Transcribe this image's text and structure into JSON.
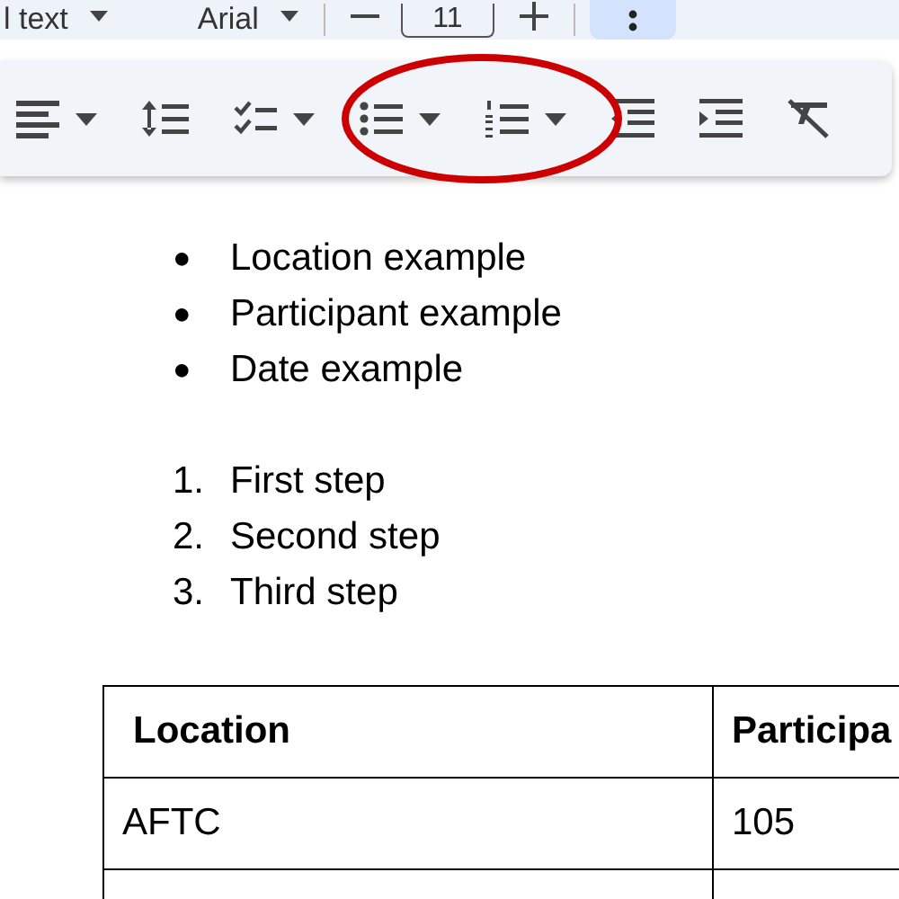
{
  "top_bar": {
    "style": "l text",
    "font": "Arial",
    "size": "11"
  },
  "toolbar": {
    "highlighted_group": true
  },
  "bulleted_list": [
    {
      "marker": "●",
      "text": "Location example"
    },
    {
      "marker": "●",
      "text": "Participant example"
    },
    {
      "marker": "●",
      "text": "Date example"
    }
  ],
  "numbered_list": [
    {
      "marker": "1.",
      "text": "First step"
    },
    {
      "marker": "2.",
      "text": "Second step"
    },
    {
      "marker": "3.",
      "text": "Third step"
    }
  ],
  "table": {
    "columns": [
      "Location",
      "Participa"
    ],
    "rows": [
      [
        "AFTC",
        "105"
      ]
    ]
  }
}
